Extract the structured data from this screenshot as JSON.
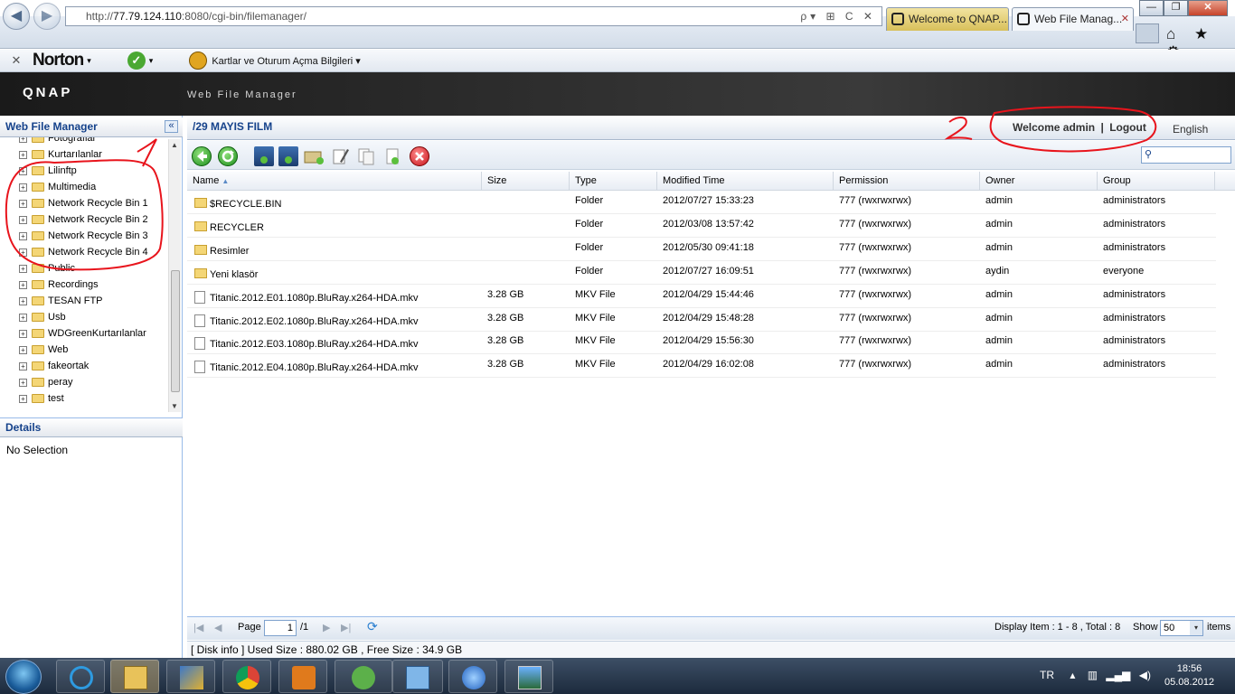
{
  "browser": {
    "window_buttons": [
      "—",
      "❐",
      "✕"
    ],
    "url_prefix": "http://",
    "url_host": "77.79.124.110",
    "url_rest": ":8080/cgi-bin/filemanager/",
    "address_icons": "ρ▾ ⊞ C ✕",
    "tabs": [
      {
        "label": "Welcome to QNAP..."
      },
      {
        "label": "Web File Manag..."
      }
    ],
    "tab_close": "✕",
    "toolbar_right_icons": "⌂ ★ ⚙"
  },
  "norton": {
    "close": "✕",
    "logo": "Norton",
    "logo_caret": "▾",
    "check_caret": "▾",
    "card_label": "Kartlar ve Oturum Açma Bilgileri ▾"
  },
  "header": {
    "logo": "QNAP",
    "title": "Web File Manager"
  },
  "left": {
    "title": "Web File Manager",
    "collapse": "«",
    "tree": [
      {
        "label": "Fotograflar"
      },
      {
        "label": "Kurtarılanlar"
      },
      {
        "label": "Lilinftp"
      },
      {
        "label": "Multimedia"
      },
      {
        "label": "Network Recycle Bin 1"
      },
      {
        "label": "Network Recycle Bin 2"
      },
      {
        "label": "Network Recycle Bin 3"
      },
      {
        "label": "Network Recycle Bin 4"
      },
      {
        "label": "Public"
      },
      {
        "label": "Recordings"
      },
      {
        "label": "TESAN FTP"
      },
      {
        "label": "Usb"
      },
      {
        "label": "WDGreenKurtarılanlar"
      },
      {
        "label": "Web"
      },
      {
        "label": "fakeortak"
      },
      {
        "label": "peray"
      },
      {
        "label": "test"
      }
    ],
    "details_title": "Details",
    "details_text": "No Selection"
  },
  "main": {
    "path": "/29 MAYIS FILM",
    "welcome": "Welcome admin",
    "separator": "|",
    "logout": "Logout",
    "language": "English",
    "columns": [
      "Name",
      "Size",
      "Type",
      "Modified Time",
      "Permission",
      "Owner",
      "Group"
    ],
    "sort_indicator": "▲",
    "rows": [
      {
        "name": "$RECYCLE.BIN",
        "size": "",
        "type": "Folder",
        "modified": "2012/07/27 15:33:23",
        "perm": "777 (rwxrwxrwx)",
        "owner": "admin",
        "group": "administrators",
        "kind": "folder"
      },
      {
        "name": "RECYCLER",
        "size": "",
        "type": "Folder",
        "modified": "2012/03/08 13:57:42",
        "perm": "777 (rwxrwxrwx)",
        "owner": "admin",
        "group": "administrators",
        "kind": "folder"
      },
      {
        "name": "Resimler",
        "size": "",
        "type": "Folder",
        "modified": "2012/05/30 09:41:18",
        "perm": "777 (rwxrwxrwx)",
        "owner": "admin",
        "group": "administrators",
        "kind": "folder"
      },
      {
        "name": "Yeni klasör",
        "size": "",
        "type": "Folder",
        "modified": "2012/07/27 16:09:51",
        "perm": "777 (rwxrwxrwx)",
        "owner": "aydin",
        "group": "everyone",
        "kind": "folder"
      },
      {
        "name": "Titanic.2012.E01.1080p.BluRay.x264-HDA.mkv",
        "size": "3.28 GB",
        "type": "MKV File",
        "modified": "2012/04/29 15:44:46",
        "perm": "777 (rwxrwxrwx)",
        "owner": "admin",
        "group": "administrators",
        "kind": "file"
      },
      {
        "name": "Titanic.2012.E02.1080p.BluRay.x264-HDA.mkv",
        "size": "3.28 GB",
        "type": "MKV File",
        "modified": "2012/04/29 15:48:28",
        "perm": "777 (rwxrwxrwx)",
        "owner": "admin",
        "group": "administrators",
        "kind": "file"
      },
      {
        "name": "Titanic.2012.E03.1080p.BluRay.x264-HDA.mkv",
        "size": "3.28 GB",
        "type": "MKV File",
        "modified": "2012/04/29 15:56:30",
        "perm": "777 (rwxrwxrwx)",
        "owner": "admin",
        "group": "administrators",
        "kind": "file"
      },
      {
        "name": "Titanic.2012.E04.1080p.BluRay.x264-HDA.mkv",
        "size": "3.28 GB",
        "type": "MKV File",
        "modified": "2012/04/29 16:02:08",
        "perm": "777 (rwxrwxrwx)",
        "owner": "admin",
        "group": "administrators",
        "kind": "file"
      }
    ],
    "paging": {
      "first": "|◀",
      "prev": "◀",
      "page_label": "Page",
      "page_value": "1",
      "of_total": "/1",
      "next": "▶",
      "last": "▶|",
      "refresh": "⟳",
      "display_text": "Display Item : 1 - 8 , Total : 8",
      "show_label": "Show",
      "page_size": "50",
      "page_size_caret": "▾",
      "items_label": "items"
    },
    "disk_info": "[ Disk info ] Used Size : 880.02 GB , Free Size : 34.9 GB"
  },
  "annotations": {
    "mark_1": "1",
    "mark_2": "2",
    "color": "#e8141c"
  },
  "taskbar": {
    "language": "TR",
    "time": "18:56",
    "date": "05.08.2012"
  }
}
